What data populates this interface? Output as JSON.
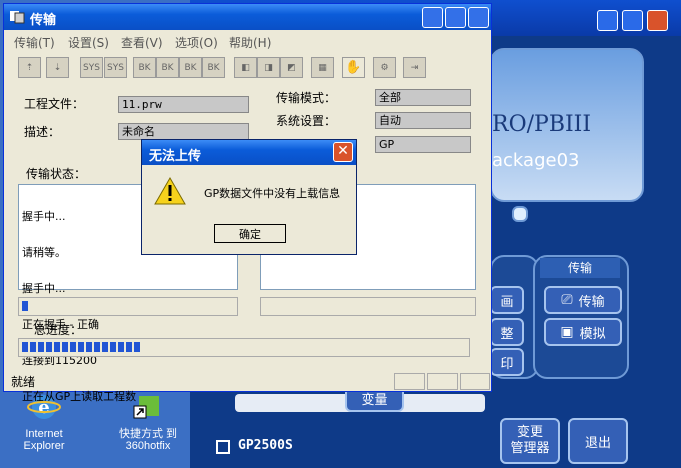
{
  "window": {
    "title": "传输"
  },
  "menu": [
    "传输(T)",
    "设置(S)",
    "查看(V)",
    "选项(O)",
    "帮助(H)"
  ],
  "form": {
    "project_file_label": "工程文件：",
    "project_file_value": "11.prw",
    "description_label": "描述：",
    "description_value": "未命名",
    "transfer_mode_label": "传输模式：",
    "transfer_mode_value": "全部",
    "system_setting_label": "系统设置：",
    "system_setting_value": "自动",
    "gp_value": "GP",
    "transfer_status_label": "传输状态："
  },
  "log_lines": [
    "握手中...",
    "请稍等。",
    "握手中...",
    "正在握手 - 正确",
    "连接到115200",
    "正在从GP上读取工程数"
  ],
  "total_progress_label": "总进度：",
  "statusbar": {
    "text": "就绪"
  },
  "dialog": {
    "title": "无法上传",
    "message": "GP数据文件中没有上载信息",
    "ok_label": "确定"
  },
  "desktop": {
    "ie_label_1": "Internet",
    "ie_label_2": "Explorer",
    "shortcut_label_1": "快捷方式 到",
    "shortcut_label_2": "360hotfix"
  },
  "backapp": {
    "logo_text": "RO/PBIII",
    "package_text": "ackage03",
    "section_transfer": "传输",
    "btn_transfer": "传输",
    "btn_simulate": "模拟",
    "partial_1": "画",
    "partial_2": "整",
    "partial_3": "印",
    "partial_4": "变量",
    "gp_model": "GP2500S",
    "change_manager_1": "变更",
    "change_manager_2": "管理器",
    "exit": "退出"
  },
  "progress": {
    "status_fraction": 0.05,
    "total_fraction": 0.27
  }
}
